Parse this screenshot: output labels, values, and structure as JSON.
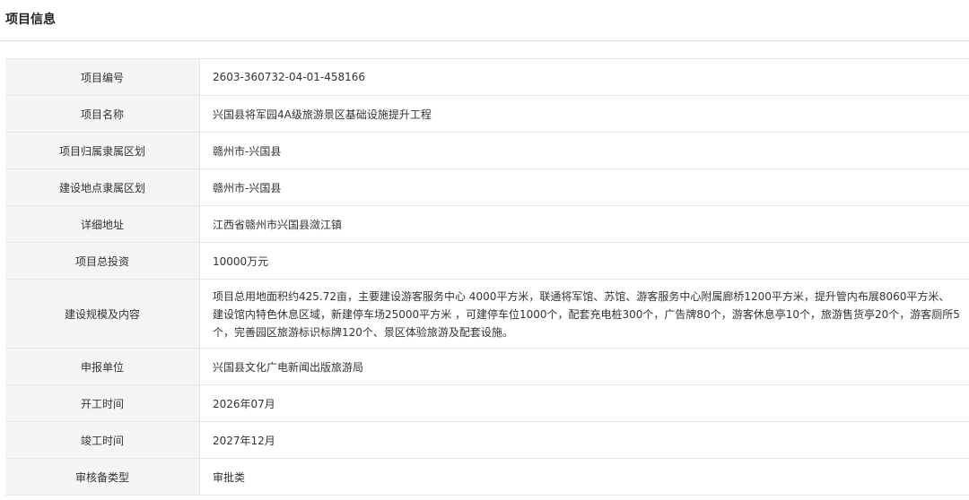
{
  "section": {
    "title": "项目信息"
  },
  "rows": [
    {
      "label": "项目编号",
      "value": "2603-360732-04-01-458166"
    },
    {
      "label": "项目名称",
      "value": "兴国县将军园4A级旅游景区基础设施提升工程"
    },
    {
      "label": "项目归属隶属区划",
      "value": "赣州市-兴国县"
    },
    {
      "label": "建设地点隶属区划",
      "value": "赣州市-兴国县"
    },
    {
      "label": "详细地址",
      "value": "江西省赣州市兴国县潋江镇"
    },
    {
      "label": "项目总投资",
      "value": "10000万元"
    },
    {
      "label": "建设规模及内容",
      "value": "项目总用地面积约425.72亩，主要建设游客服务中心 4000平方米，联通将军馆、苏馆、游客服务中心附属廊桥1200平方米，提升管内布展8060平方米、建设馆内特色休息区域，新建停车场25000平方米 ，可建停车位1000个，配套充电桩300个，广告牌80个，游客休息亭10个，旅游售货亭20个，游客厕所5个，完善园区旅游标识标牌120个、景区体验旅游及配套设施。"
    },
    {
      "label": "申报单位",
      "value": "兴国县文化广电新闻出版旅游局"
    },
    {
      "label": "开工时间",
      "value": "2026年07月"
    },
    {
      "label": "竣工时间",
      "value": "2027年12月"
    },
    {
      "label": "审核备类型",
      "value": "审批类"
    }
  ]
}
